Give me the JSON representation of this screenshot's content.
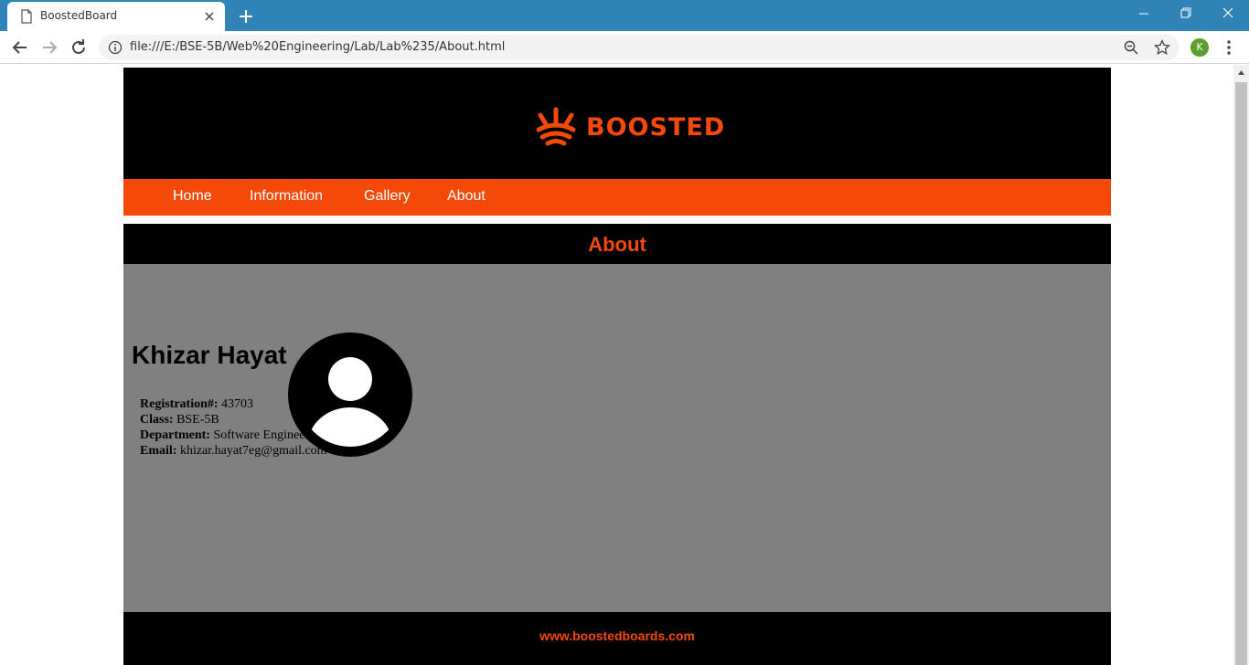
{
  "browser": {
    "tab_title": "BoostedBoard",
    "url": "file:///E:/BSE-5B/Web%20Engineering/Lab/Lab%235/About.html",
    "profile_initial": "K",
    "accent": "#3083b7"
  },
  "site": {
    "brand": "BOOSTED",
    "brand_color": "#f5490a",
    "nav": [
      "Home",
      "Information",
      "Gallery",
      "About"
    ],
    "section_title": "About"
  },
  "profile": {
    "name": "Khizar Hayat",
    "fields": [
      {
        "label": "Registration#:",
        "value": "43703"
      },
      {
        "label": "Class:",
        "value": "BSE-5B"
      },
      {
        "label": "Department:",
        "value": "Software Engineering"
      },
      {
        "label": "Email:",
        "value": "khizar.hayat7eg@gmail.com"
      }
    ]
  },
  "footer": {
    "link": "www.boostedboards.com"
  }
}
